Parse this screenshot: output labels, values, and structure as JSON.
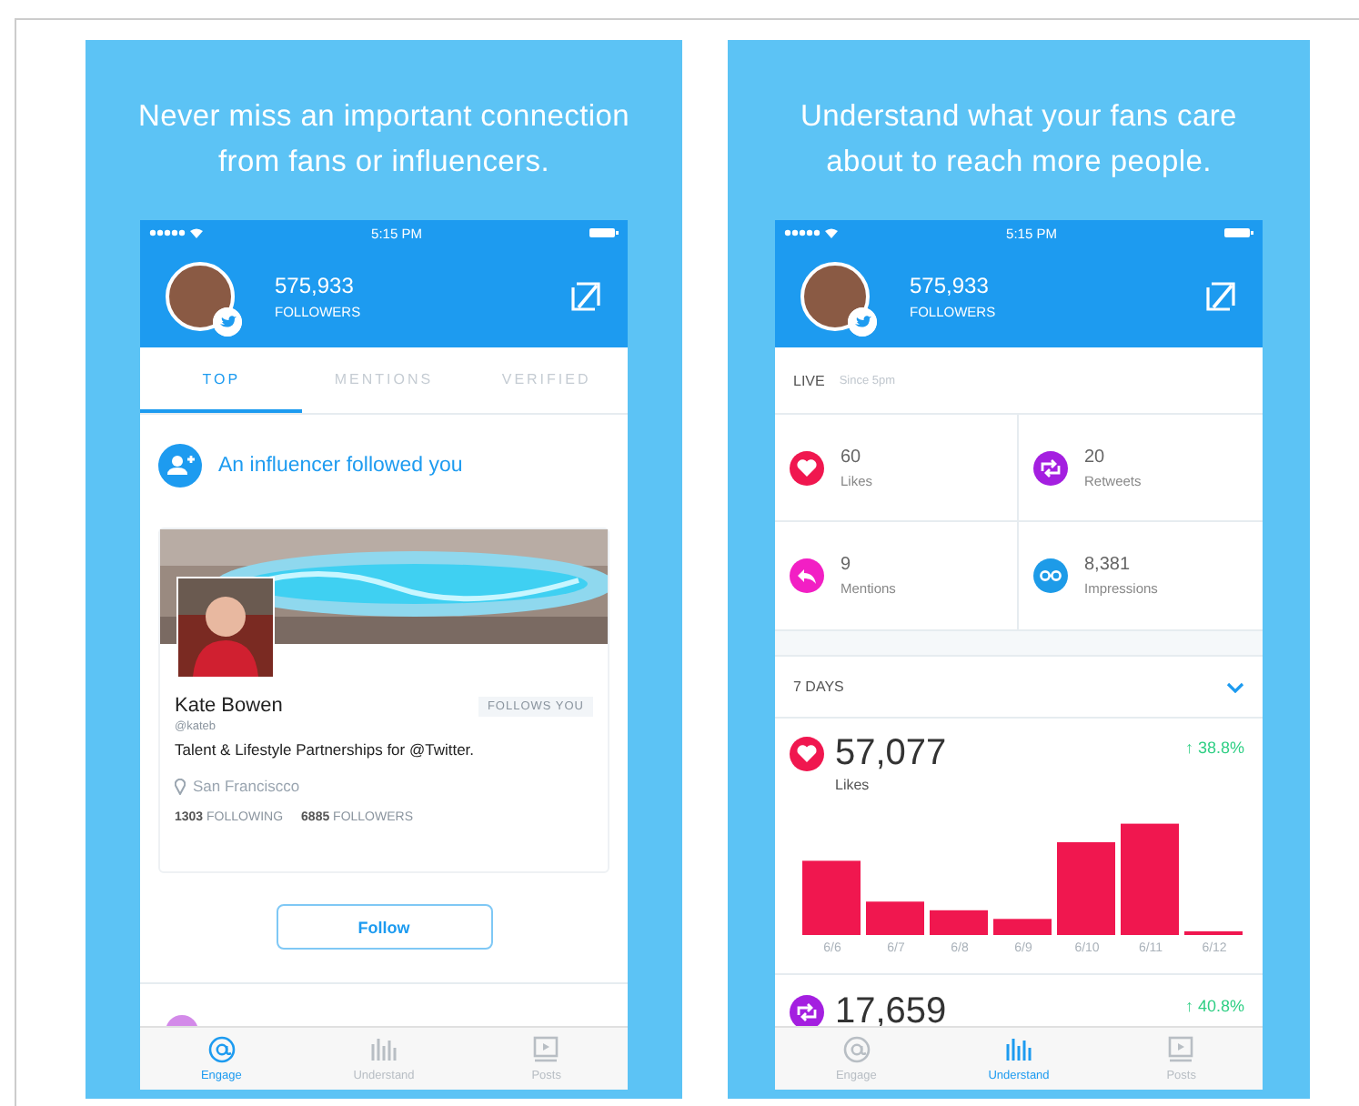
{
  "panels": [
    {
      "caption": "Never miss an important connection\nfrom fans or influencers.",
      "phone": {
        "time": "5:15 PM",
        "followers": {
          "count": "575,933",
          "label": "FOLLOWERS"
        },
        "body": {
          "kind": "engage",
          "tabs": [
            {
              "label": "TOP",
              "selected": true
            },
            {
              "label": "MENTIONS",
              "selected": false
            },
            {
              "label": "VERIFIED",
              "selected": false
            }
          ],
          "notification": "An influencer followed you",
          "profile": {
            "name": "Kate Bowen",
            "handle": "@kateb",
            "badge": "FOLLOWS YOU",
            "bio": "Talent & Lifestyle Partnerships for @Twitter.",
            "location": "San Franciscco",
            "following": {
              "count": "1303",
              "label": "FOLLOWING"
            },
            "followers": {
              "count": "6885",
              "label": "FOLLOWERS"
            }
          },
          "button": "Follow"
        },
        "tabbar": [
          {
            "kind": "at",
            "label": "Engage",
            "selected": true
          },
          {
            "kind": "bars",
            "label": "Understand",
            "selected": false
          },
          {
            "kind": "play",
            "label": "Posts",
            "selected": false
          }
        ]
      }
    },
    {
      "caption": "Understand what your fans care\nabout to reach more people.",
      "phone": {
        "time": "5:15 PM",
        "followers": {
          "count": "575,933",
          "label": "FOLLOWERS"
        },
        "body": {
          "kind": "understand",
          "live": {
            "label": "LIVE",
            "since": "Since 5pm"
          },
          "stats": [
            {
              "kind": "heart",
              "value": "60",
              "label": "Likes",
              "color": "#f0174f"
            },
            {
              "kind": "retweet",
              "value": "20",
              "label": "Retweets",
              "color": "#a41fe0"
            },
            {
              "kind": "reply",
              "value": "9",
              "label": "Mentions",
              "color": "#f21fc4"
            },
            {
              "kind": "glasses",
              "value": "8,381",
              "label": "Impressions",
              "color": "#1d9be8"
            }
          ],
          "period": "7 DAYS",
          "metrics": [
            {
              "kind": "heart",
              "color": "#f0174f",
              "value": "57,077",
              "label": "Likes",
              "change": "↑ 38.8%",
              "dates": [
                "6/6",
                "6/7",
                "6/8",
                "6/9",
                "6/10",
                "6/11",
                "6/12"
              ]
            },
            {
              "kind": "retweet",
              "color": "#a41fe0",
              "value": "17,659",
              "change": "↑ 40.8%"
            }
          ]
        },
        "tabbar": [
          {
            "kind": "at",
            "label": "Engage",
            "selected": false
          },
          {
            "kind": "bars",
            "label": "Understand",
            "selected": true
          },
          {
            "kind": "play",
            "label": "Posts",
            "selected": false
          }
        ]
      }
    }
  ]
}
